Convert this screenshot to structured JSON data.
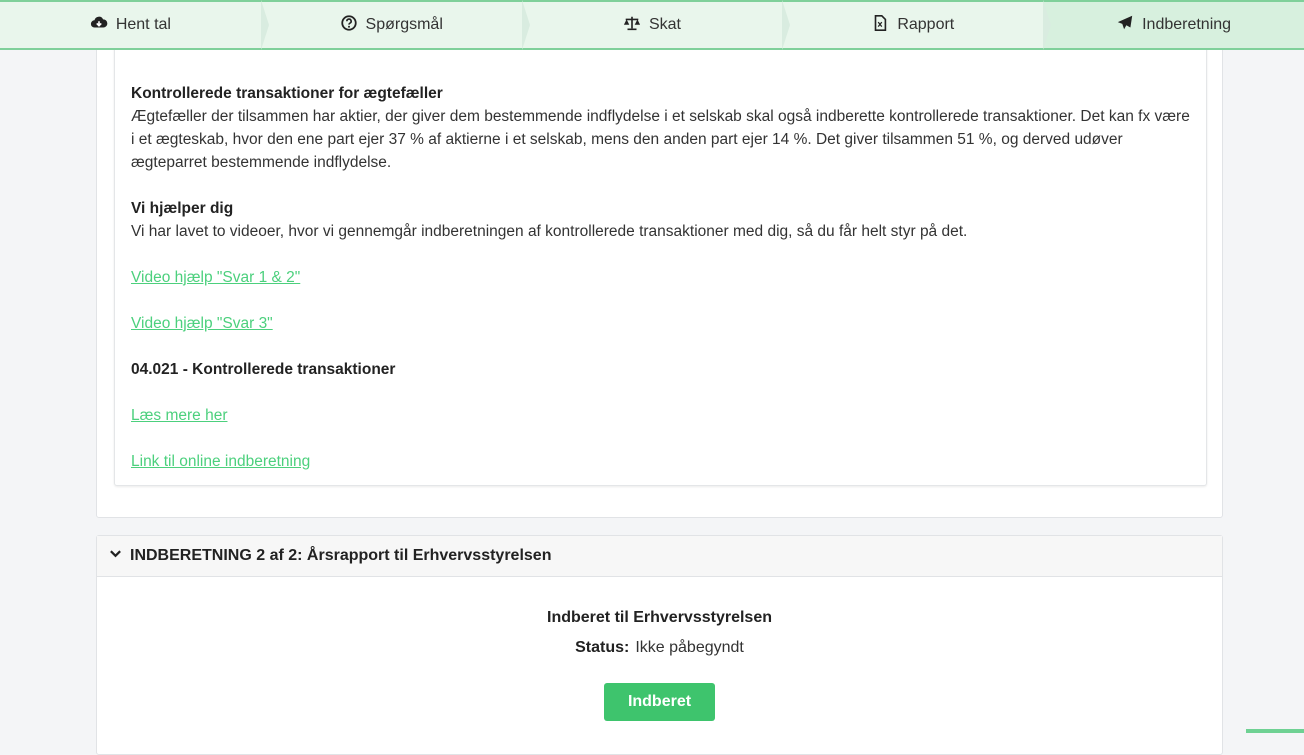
{
  "nav": {
    "steps": [
      {
        "label": "Hent tal",
        "icon": "cloud-download-icon"
      },
      {
        "label": "Spørgsmål",
        "icon": "question-circle-icon"
      },
      {
        "label": "Skat",
        "icon": "scale-icon"
      },
      {
        "label": "Rapport",
        "icon": "pdf-file-icon"
      },
      {
        "label": "Indberetning",
        "icon": "paper-plane-icon"
      }
    ],
    "active_index": 4
  },
  "content": {
    "spouses_heading": "Kontrollerede transaktioner for ægtefæller",
    "spouses_text": "Ægtefæller der tilsammen har aktier, der giver dem bestemmende indflydelse i et selskab skal også indberette kontrollerede transaktioner. Det kan fx være i et ægteskab, hvor den ene part ejer 37 % af aktierne i et selskab, mens den anden part ejer 14 %. Det giver tilsammen 51 %, og derved udøver ægteparret bestemmende indflydelse.",
    "help_heading": "Vi hjælper dig",
    "help_text": "Vi har lavet to videoer, hvor vi gennemgår indberetningen af kontrollerede transaktioner med dig, så du får helt styr på det.",
    "video_link_1": "Video hjælp \"Svar 1 & 2\"",
    "video_link_2": "Video hjælp \"Svar 3\"",
    "section_heading": "04.021 - Kontrollerede transaktioner",
    "read_more_link": "Læs mere her",
    "online_link": "Link til online indberetning"
  },
  "accordion": {
    "header": "INDBERETNING 2 af 2: Årsrapport til Erhvervsstyrelsen",
    "title": "Indberet til Erhvervsstyrelsen",
    "status_label": "Status:",
    "status_value": "Ikke påbegyndt",
    "button_label": "Indberet"
  },
  "colors": {
    "accent": "#3ec46d",
    "link": "#4cd07d",
    "nav_bg": "#e9f6ec"
  }
}
